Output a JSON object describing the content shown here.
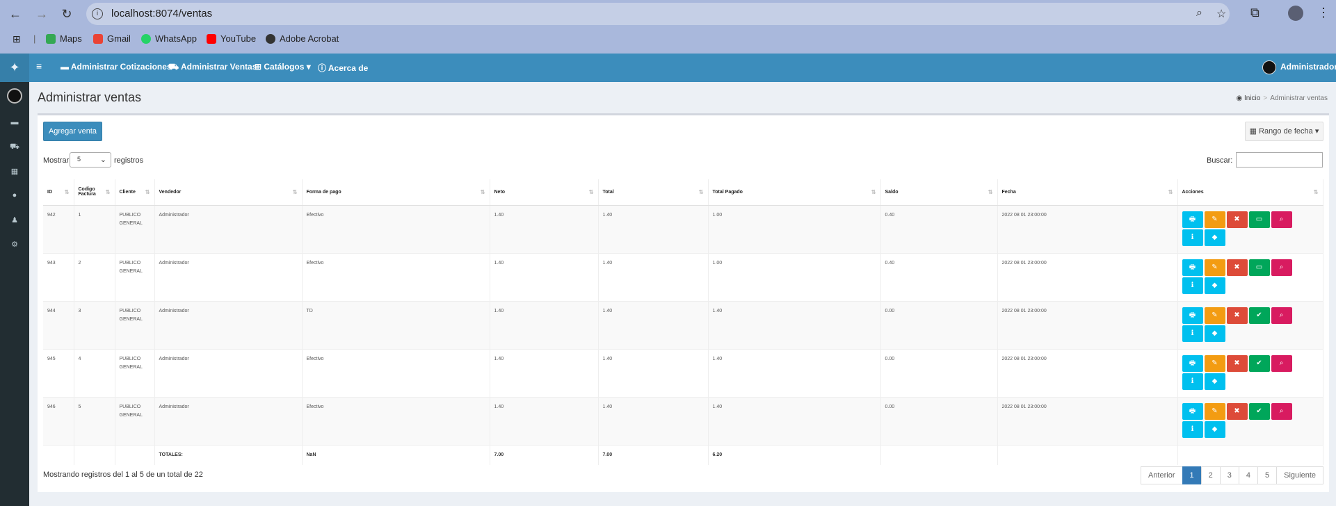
{
  "browser": {
    "url": "localhost:8074/ventas",
    "bookmarks": [
      "Maps",
      "Gmail",
      "WhatsApp",
      "YouTube",
      "Adobe Acrobat"
    ]
  },
  "topbar": {
    "items": [
      "Administrar Cotizaciones",
      "Administrar Ventas",
      "Catálogos",
      "Acerca de"
    ],
    "user": "Administrador"
  },
  "page": {
    "title": "Administrar ventas",
    "breadcrumb": [
      "Inicio",
      "Administrar ventas"
    ]
  },
  "toolbar": {
    "add_label": "Agregar venta",
    "range_label": "Rango de fecha"
  },
  "table_controls": {
    "show_label": "Mostrar",
    "length_value": "5",
    "records_label": "registros",
    "search_label": "Buscar:"
  },
  "table": {
    "headers": [
      "ID",
      "Codigo Factura",
      "Cliente",
      "Vendedor",
      "Forma de pago",
      "Neto",
      "Total",
      "Total Pagado",
      "Saldo",
      "Fecha",
      "Acciones"
    ],
    "rows": [
      {
        "id": "942",
        "codigo": "1",
        "cliente": "PUBLICO GENERAL",
        "vendedor": "Administrador",
        "forma": "Efectivo",
        "neto": "1.40",
        "total": "1.40",
        "pagado": "1.00",
        "saldo": "0.40",
        "fecha": "2022 08 01 23:00:00",
        "paid": false
      },
      {
        "id": "943",
        "codigo": "2",
        "cliente": "PUBLICO GENERAL",
        "vendedor": "Administrador",
        "forma": "Efectivo",
        "neto": "1.40",
        "total": "1.40",
        "pagado": "1.00",
        "saldo": "0.40",
        "fecha": "2022 08 01 23:00:00",
        "paid": false
      },
      {
        "id": "944",
        "codigo": "3",
        "cliente": "PUBLICO GENERAL",
        "vendedor": "Administrador",
        "forma": "TD",
        "neto": "1.40",
        "total": "1.40",
        "pagado": "1.40",
        "saldo": "0.00",
        "fecha": "2022 08 01 23:00:00",
        "paid": true
      },
      {
        "id": "945",
        "codigo": "4",
        "cliente": "PUBLICO GENERAL",
        "vendedor": "Administrador",
        "forma": "Efectivo",
        "neto": "1.40",
        "total": "1.40",
        "pagado": "1.40",
        "saldo": "0.00",
        "fecha": "2022 08 01 23:00:00",
        "paid": true
      },
      {
        "id": "946",
        "codigo": "5",
        "cliente": "PUBLICO GENERAL",
        "vendedor": "Administrador",
        "forma": "Efectivo",
        "neto": "1.40",
        "total": "1.40",
        "pagado": "1.40",
        "saldo": "0.00",
        "fecha": "2022 08 01 23:00:00",
        "paid": true
      }
    ],
    "totals": {
      "label": "TOTALES:",
      "forma": "NaN",
      "neto": "7.00",
      "total": "7.00",
      "pagado": "6.20"
    }
  },
  "footer": {
    "info": "Mostrando registros del 1 al 5 de un total de 22",
    "pages": [
      "Anterior",
      "1",
      "2",
      "3",
      "4",
      "5",
      "Siguiente"
    ],
    "active_page": "1"
  },
  "colors": {
    "topbar": "#3c8dbc",
    "sidebar": "#222d32",
    "print": "#00c0ef",
    "edit": "#f39c12",
    "delete": "#dd4b39",
    "pay": "#00a65a",
    "view": "#d81b60"
  }
}
